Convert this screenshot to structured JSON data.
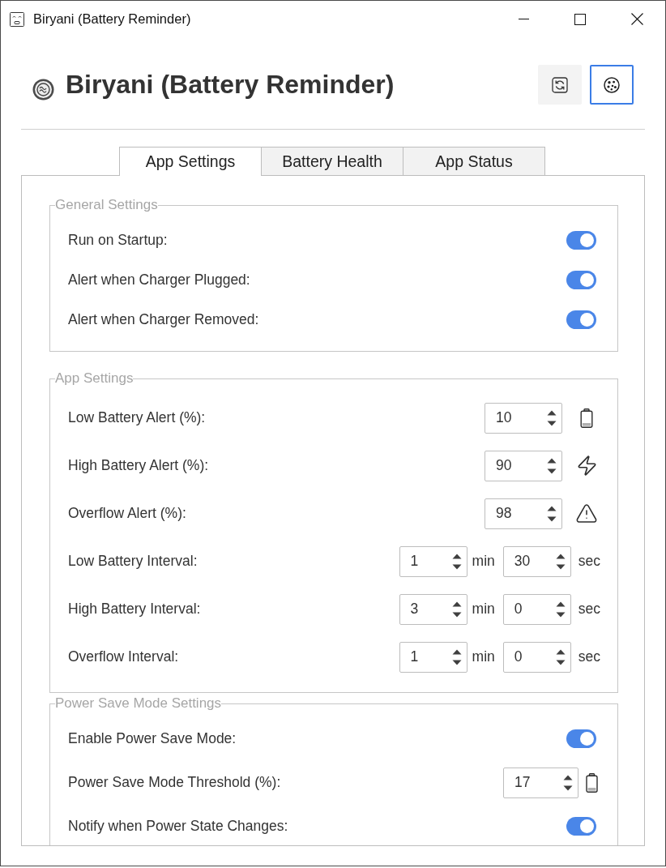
{
  "window": {
    "title": "Biryani (Battery Reminder)"
  },
  "header": {
    "title": "Biryani (Battery Reminder)",
    "buttons": [
      {
        "kind": "refresh",
        "focused": false
      },
      {
        "kind": "palette",
        "focused": true
      }
    ]
  },
  "tabs": [
    {
      "label": "App Settings",
      "selected": true
    },
    {
      "label": "Battery Health",
      "selected": false
    },
    {
      "label": "App Status",
      "selected": false
    }
  ],
  "sections": [
    {
      "legend": "General Settings",
      "rows": [
        {
          "kind": "toggle",
          "label": "Run on Startup:",
          "on": true
        },
        {
          "kind": "toggle",
          "label": "Alert when Charger Plugged:",
          "on": true
        },
        {
          "kind": "toggle",
          "label": "Alert when Charger Removed:",
          "on": true
        }
      ]
    },
    {
      "legend": "App Settings",
      "rows": [
        {
          "kind": "number",
          "label": "Low Battery Alert (%):",
          "value": "10"
        },
        {
          "kind": "number",
          "label": "High Battery Alert (%):",
          "value": "90"
        },
        {
          "kind": "number",
          "label": "Overflow Alert (%):",
          "value": "98"
        },
        {
          "kind": "interval",
          "label": "Low Battery Interval:",
          "minutes": "1",
          "minutes_unit": "min",
          "seconds": "30",
          "seconds_unit": "sec"
        },
        {
          "kind": "interval",
          "label": "High Battery Interval:",
          "minutes": "3",
          "minutes_unit": "min",
          "seconds": "0",
          "seconds_unit": "sec"
        },
        {
          "kind": "interval",
          "label": "Overflow Interval:",
          "minutes": "1",
          "minutes_unit": "min",
          "seconds": "0",
          "seconds_unit": "sec"
        }
      ]
    },
    {
      "legend": "Power Save Mode Settings",
      "rows": [
        {
          "kind": "toggle",
          "label": "Enable Power Save Mode:",
          "on": true
        },
        {
          "kind": "number",
          "label": "Power Save Mode Threshold (%):",
          "value": "17"
        },
        {
          "kind": "toggle",
          "label": "Notify when Power State Changes:",
          "on": true
        }
      ]
    }
  ]
}
